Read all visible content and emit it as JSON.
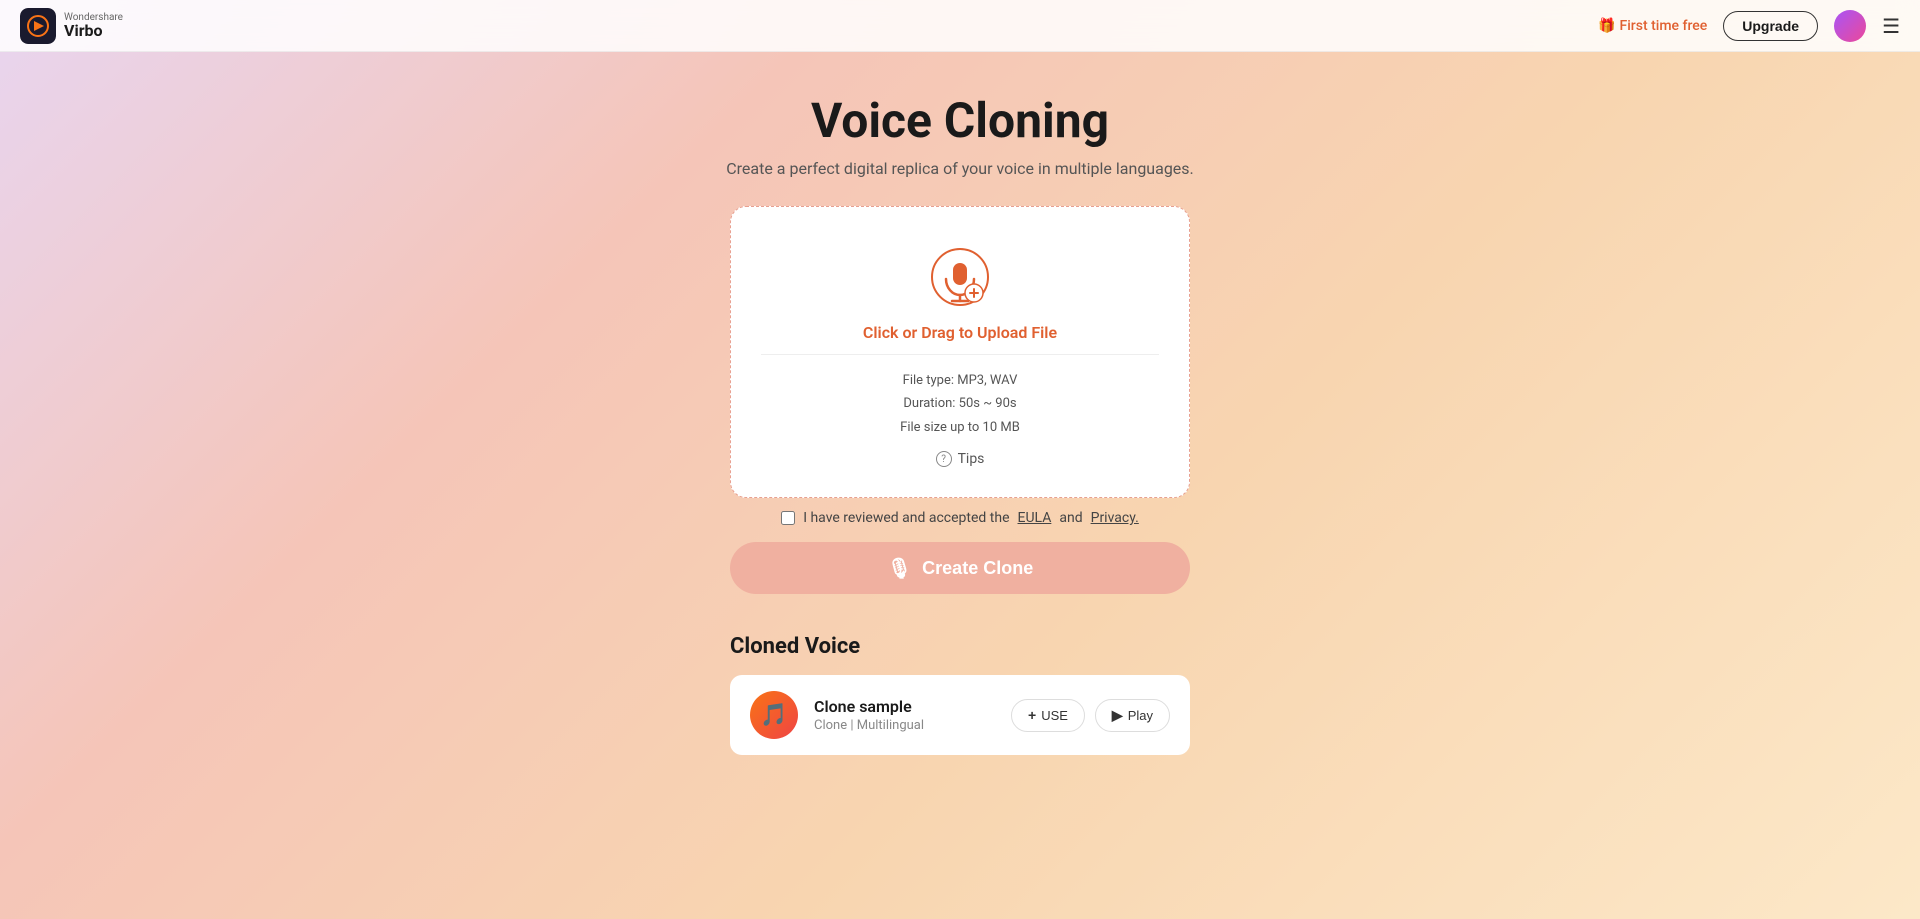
{
  "header": {
    "logo_brand": "Wondershare",
    "logo_product": "Virbo",
    "first_time_free": "First time free",
    "upgrade_label": "Upgrade",
    "menu_label": "Menu"
  },
  "page": {
    "title": "Voice Cloning",
    "subtitle": "Create a perfect digital replica of your voice in multiple languages.",
    "upload": {
      "label": "Click or Drag to Upload File",
      "file_type": "File type: MP3, WAV",
      "duration": "Duration: 50s ~ 90s",
      "file_size": "File size up to 10 MB",
      "tips_label": "Tips"
    },
    "agreement": {
      "text_before": "I have reviewed and accepted the",
      "eula_label": "EULA",
      "text_middle": "and",
      "privacy_label": "Privacy."
    },
    "create_clone_btn": "Create Clone",
    "cloned_section": {
      "title": "Cloned Voice",
      "items": [
        {
          "name": "Clone sample",
          "meta": "Clone | Multilingual",
          "use_label": "USE",
          "play_label": "Play"
        }
      ]
    }
  }
}
